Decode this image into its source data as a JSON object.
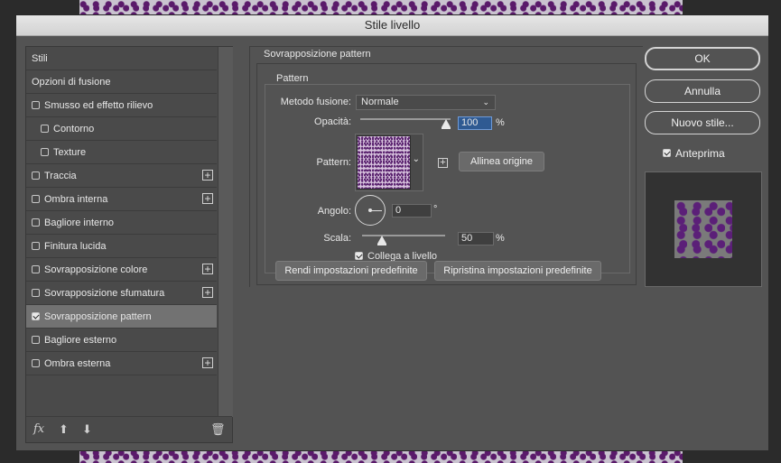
{
  "dialog": {
    "title": "Stile livello"
  },
  "left": {
    "items": [
      {
        "label": "Stili",
        "checkbox": false,
        "checked": false,
        "plus": false
      },
      {
        "label": "Opzioni di fusione",
        "checkbox": false,
        "checked": false,
        "plus": false
      },
      {
        "label": "Smusso ed effetto rilievo",
        "checkbox": true,
        "checked": false,
        "plus": false
      },
      {
        "label": "Contorno",
        "checkbox": true,
        "checked": false,
        "plus": false,
        "indent": true
      },
      {
        "label": "Texture",
        "checkbox": true,
        "checked": false,
        "plus": false,
        "indent": true
      },
      {
        "label": "Traccia",
        "checkbox": true,
        "checked": false,
        "plus": true
      },
      {
        "label": "Ombra interna",
        "checkbox": true,
        "checked": false,
        "plus": true
      },
      {
        "label": "Bagliore interno",
        "checkbox": true,
        "checked": false,
        "plus": false
      },
      {
        "label": "Finitura lucida",
        "checkbox": true,
        "checked": false,
        "plus": false
      },
      {
        "label": "Sovrapposizione colore",
        "checkbox": true,
        "checked": false,
        "plus": true
      },
      {
        "label": "Sovrapposizione sfumatura",
        "checkbox": true,
        "checked": false,
        "plus": true
      },
      {
        "label": "Sovrapposizione pattern",
        "checkbox": true,
        "checked": true,
        "plus": false,
        "selected": true
      },
      {
        "label": "Bagliore esterno",
        "checkbox": true,
        "checked": false,
        "plus": false
      },
      {
        "label": "Ombra esterna",
        "checkbox": true,
        "checked": false,
        "plus": true
      }
    ],
    "footer": {
      "fx_icon": "fx-icon",
      "up_icon": "arrow-up-icon",
      "down_icon": "arrow-down-icon",
      "trash_icon": "trash-icon"
    }
  },
  "panel": {
    "section_title": "Sovrapposizione pattern",
    "group_title": "Pattern",
    "blend_label": "Metodo fusione:",
    "blend_value": "Normale",
    "opacity_label": "Opacità:",
    "opacity_value": "100",
    "opacity_unit": "%",
    "opacity_level": 1.0,
    "pattern_label": "Pattern:",
    "snap_button": "Allinea origine",
    "angle_label": "Angolo:",
    "angle_value": "0",
    "angle_unit": "°",
    "scale_label": "Scala:",
    "scale_value": "50",
    "scale_unit": "%",
    "link_label": "Collega a livello",
    "link_checked": true,
    "default_button": "Rendi impostazioni predefinite",
    "reset_button": "Ripristina impostazioni predefinite"
  },
  "right": {
    "ok": "OK",
    "cancel": "Annulla",
    "new_style": "Nuovo stile...",
    "preview_label": "Anteprima",
    "preview_checked": true
  }
}
